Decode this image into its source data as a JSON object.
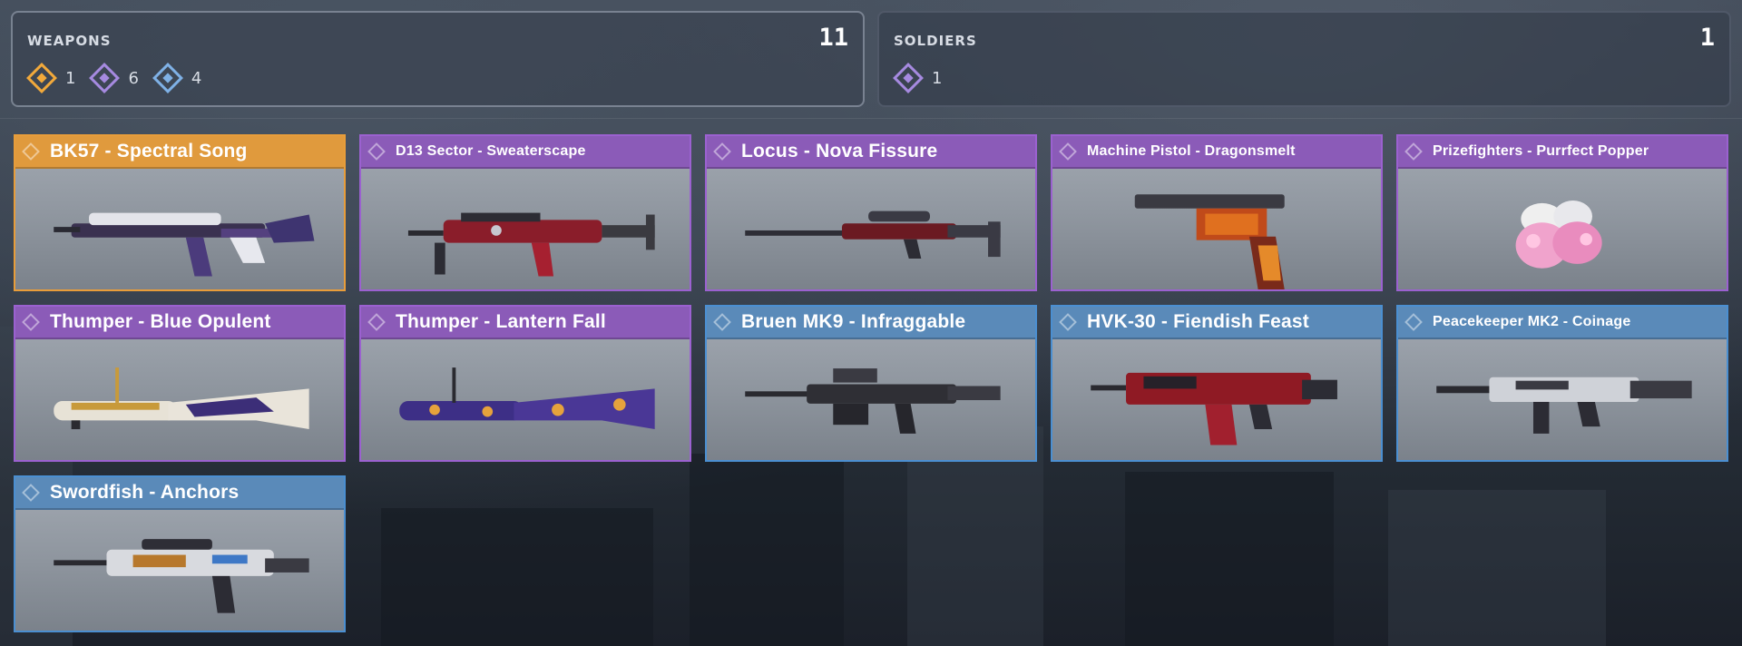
{
  "summary": {
    "weapons": {
      "label": "WEAPONS",
      "total": "11",
      "rarities": [
        {
          "tier": "gold",
          "icon": "legendary-diamond-icon",
          "count": "1"
        },
        {
          "tier": "purple",
          "icon": "epic-diamond-icon",
          "count": "6"
        },
        {
          "tier": "blue",
          "icon": "rare-diamond-icon",
          "count": "4"
        }
      ]
    },
    "soldiers": {
      "label": "SOLDIERS",
      "total": "1",
      "rarities": [
        {
          "tier": "purple",
          "icon": "epic-diamond-icon",
          "count": "1"
        }
      ]
    }
  },
  "colors": {
    "legendary": "#e09a3d",
    "epic": "#8b5bb8",
    "rare": "#5a8ab9"
  },
  "items": [
    {
      "name": "BK57 - Spectral Song",
      "tier": "gold",
      "icon": "assault-rifle-icon"
    },
    {
      "name": "D13 Sector - Sweaterscape",
      "tier": "purple",
      "icon": "assault-rifle-icon"
    },
    {
      "name": "Locus - Nova Fissure",
      "tier": "purple",
      "icon": "sniper-rifle-icon"
    },
    {
      "name": "Machine Pistol - Dragonsmelt",
      "tier": "purple",
      "icon": "pistol-icon"
    },
    {
      "name": "Prizefighters - Purrfect Popper",
      "tier": "purple",
      "icon": "boxing-gloves-icon"
    },
    {
      "name": "Thumper - Blue Opulent",
      "tier": "purple",
      "icon": "launcher-icon"
    },
    {
      "name": "Thumper - Lantern Fall",
      "tier": "purple",
      "icon": "launcher-icon"
    },
    {
      "name": "Bruen MK9 - Infraggable",
      "tier": "blue",
      "icon": "machine-gun-icon"
    },
    {
      "name": "HVK-30 - Fiendish Feast",
      "tier": "blue",
      "icon": "assault-rifle-icon"
    },
    {
      "name": "Peacekeeper MK2 - Coinage",
      "tier": "blue",
      "icon": "assault-rifle-icon"
    },
    {
      "name": "Swordfish - Anchors",
      "tier": "blue",
      "icon": "burst-rifle-icon"
    }
  ]
}
